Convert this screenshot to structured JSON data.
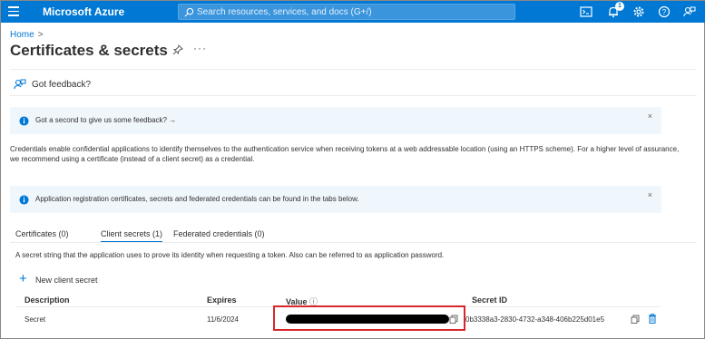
{
  "topbar": {
    "brand": "Microsoft Azure",
    "search_placeholder": "Search resources, services, and docs (G+/)",
    "notification_count": "1",
    "icons": [
      "menu-icon",
      "search-icon",
      "cloud-shell-icon",
      "notifications-icon",
      "settings-icon",
      "help-icon",
      "feedback-icon"
    ],
    "color": "#0078d4"
  },
  "breadcrumb": {
    "home": "Home",
    "separator": ">"
  },
  "page": {
    "title": "Certificates & secrets",
    "more": "···"
  },
  "toolbar": {
    "feedback_label": "Got feedback?"
  },
  "banners": [
    {
      "text": "Got a second to give us some feedback? →",
      "close": "×"
    },
    {
      "text": "Application registration certificates, secrets and federated credentials can be found in the tabs below.",
      "close": "×"
    }
  ],
  "description": "Credentials enable confidential applications to identify themselves to the authentication service when receiving tokens at a web addressable location (using an HTTPS scheme). For a higher level of assurance, we recommend using a certificate (instead of a client secret) as a credential.",
  "tabs": [
    {
      "label": "Certificates (0)",
      "active": false
    },
    {
      "label": "Client secrets (1)",
      "active": true
    },
    {
      "label": "Federated credentials (0)",
      "active": false
    }
  ],
  "tab_description": "A secret string that the application uses to prove its identity when requesting a token. Also can be referred to as application password.",
  "new_secret_label": "New client secret",
  "table": {
    "headers": {
      "description": "Description",
      "expires": "Expires",
      "value": "Value",
      "secret_id": "Secret ID"
    },
    "value_info_icon": "ⓘ",
    "rows": [
      {
        "description": "Secret",
        "expires": "11/6/2024",
        "value": "[redacted]",
        "secret_id": "0b3338a3-2830-4732-a348-406b225d01e5"
      }
    ]
  },
  "accent_color": "#0078d4",
  "highlight_color": "#d9262d"
}
